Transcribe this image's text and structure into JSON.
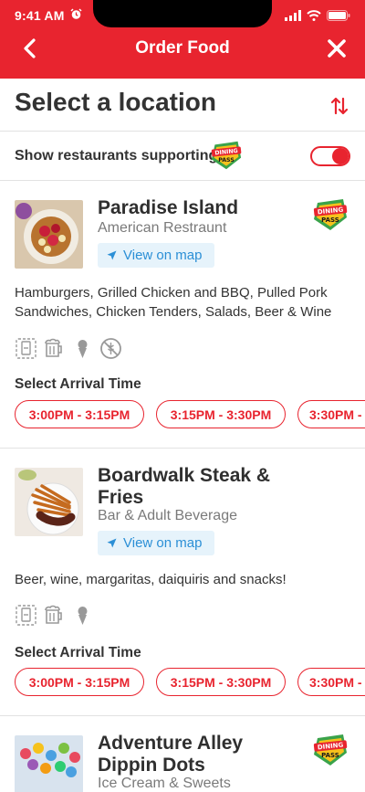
{
  "status_bar": {
    "time": "9:41 AM"
  },
  "nav": {
    "title": "Order Food"
  },
  "header": {
    "title": "Select a location"
  },
  "filter": {
    "label": "Show restaurants supporting",
    "toggle_on": true
  },
  "badge": {
    "line1": "DINING",
    "line2": "PASS"
  },
  "restaurants": [
    {
      "name": "Paradise Island",
      "category": "American Restraunt",
      "map_label": "View on map",
      "description": "Hamburgers, Grilled Chicken and BBQ, Pulled Pork Sandwiches, Chicken Tenders, Salads, Beer & Wine",
      "arrival_label": "Select Arrival Time",
      "times": [
        "3:00PM - 3:15PM",
        "3:15PM - 3:30PM",
        "3:30PM -"
      ]
    },
    {
      "name": "Boardwalk Steak & Fries",
      "category": "Bar & Adult Beverage",
      "map_label": "View on map",
      "description": "Beer, wine, margaritas, daiquiris and snacks!",
      "arrival_label": "Select Arrival Time",
      "times": [
        "3:00PM - 3:15PM",
        "3:15PM - 3:30PM",
        "3:30PM -"
      ]
    },
    {
      "name": "Adventure Alley Dippin Dots",
      "category": "Ice Cream & Sweets"
    }
  ],
  "colors": {
    "brand_red": "#e8242f",
    "map_blue": "#2b8fd6"
  }
}
